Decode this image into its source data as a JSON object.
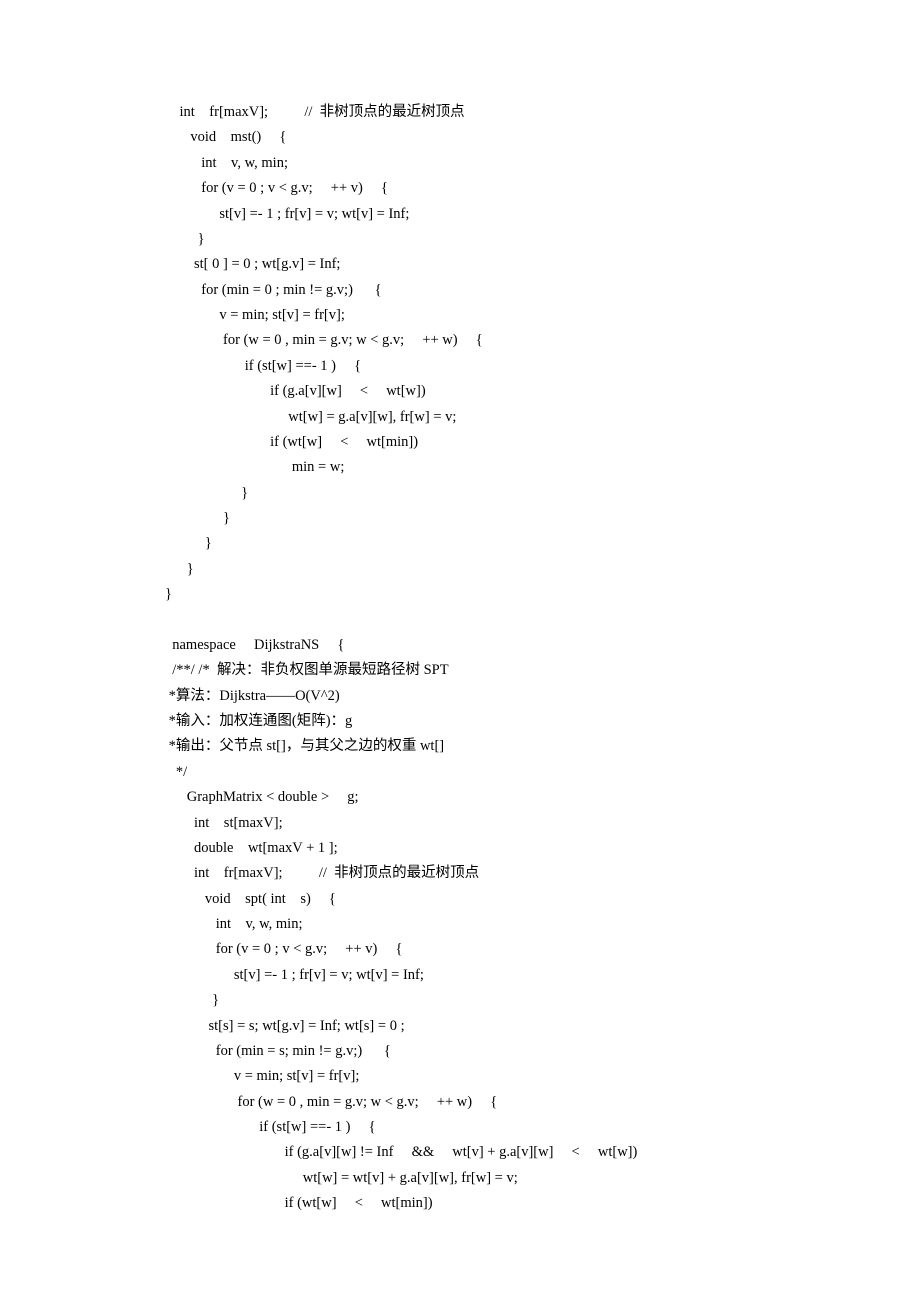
{
  "lines": [
    "    int    fr[maxV];          //  非树顶点的最近树顶点",
    "       void    mst()     {",
    "          int    v, w, min;",
    "          for (v = 0 ; v < g.v;     ++ v)     {",
    "               st[v] =- 1 ; fr[v] = v; wt[v] = Inf;",
    "         }",
    "        st[ 0 ] = 0 ; wt[g.v] = Inf;",
    "          for (min = 0 ; min != g.v;)      {",
    "               v = min; st[v] = fr[v];",
    "                for (w = 0 , min = g.v; w < g.v;     ++ w)     {",
    "                      if (st[w] ==- 1 )     {",
    "                             if (g.a[v][w]     <     wt[w])",
    "                                  wt[w] = g.a[v][w], fr[w] = v;",
    "                             if (wt[w]     <     wt[min])",
    "                                   min = w;",
    "                     }",
    "                }",
    "           }",
    "      }",
    "}",
    "",
    "  namespace     DijkstraNS     {",
    "  /**/ /*  解决：非负权图单源最短路径树 SPT",
    " *算法：Dijkstra――O(V^2)",
    " *输入：加权连通图(矩阵)：g",
    " *输出：父节点 st[]，与其父之边的权重 wt[]",
    "   */",
    "      GraphMatrix < double >     g;",
    "        int    st[maxV];",
    "        double    wt[maxV + 1 ];",
    "        int    fr[maxV];          //  非树顶点的最近树顶点",
    "           void    spt( int    s)     {",
    "              int    v, w, min;",
    "              for (v = 0 ; v < g.v;     ++ v)     {",
    "                   st[v] =- 1 ; fr[v] = v; wt[v] = Inf;",
    "             }",
    "            st[s] = s; wt[g.v] = Inf; wt[s] = 0 ;",
    "              for (min = s; min != g.v;)      {",
    "                   v = min; st[v] = fr[v];",
    "                    for (w = 0 , min = g.v; w < g.v;     ++ w)     {",
    "                          if (st[w] ==- 1 )     {",
    "                                 if (g.a[v][w] != Inf     &&     wt[v] + g.a[v][w]     <     wt[w])",
    "                                      wt[w] = wt[v] + g.a[v][w], fr[w] = v;",
    "                                 if (wt[w]     <     wt[min])"
  ]
}
